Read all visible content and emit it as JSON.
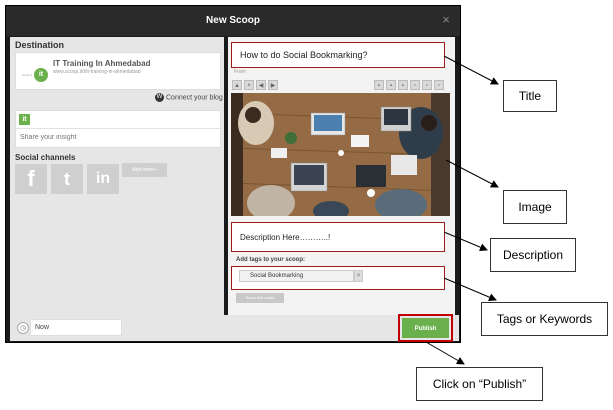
{
  "dialog": {
    "title": "New Scoop",
    "close_glyph": "×"
  },
  "destination": {
    "heading": "Destination",
    "name": "IT Training In Ahmedabad",
    "url": "www.scoop.it/t/it-training-in-ahmedabad",
    "connect_blog": "Connect your blog"
  },
  "share": {
    "placeholder": "Share your insight"
  },
  "social": {
    "heading": "Social channels",
    "buttons": [
      "f",
      "t",
      "in"
    ],
    "add_more": "Add more+"
  },
  "scheduling": {
    "value": "Now"
  },
  "editor": {
    "title": "How to do Social Bookmarking?",
    "from": "From",
    "description": "Description Here………..!",
    "tags_label": "Add tags to your scoop:",
    "tag": "Social Bookmarking",
    "show_edit": "Show edit mode"
  },
  "actions": {
    "publish": "Publish"
  },
  "callouts": {
    "title": "Title",
    "image": "Image",
    "description": "Description",
    "tags": "Tags or Keywords",
    "publish": "Click on “Publish”"
  },
  "colors": {
    "accent_green": "#6ab04c",
    "highlight_red": "#9e1b1b",
    "dialog_bg": "#1a1a1a"
  }
}
